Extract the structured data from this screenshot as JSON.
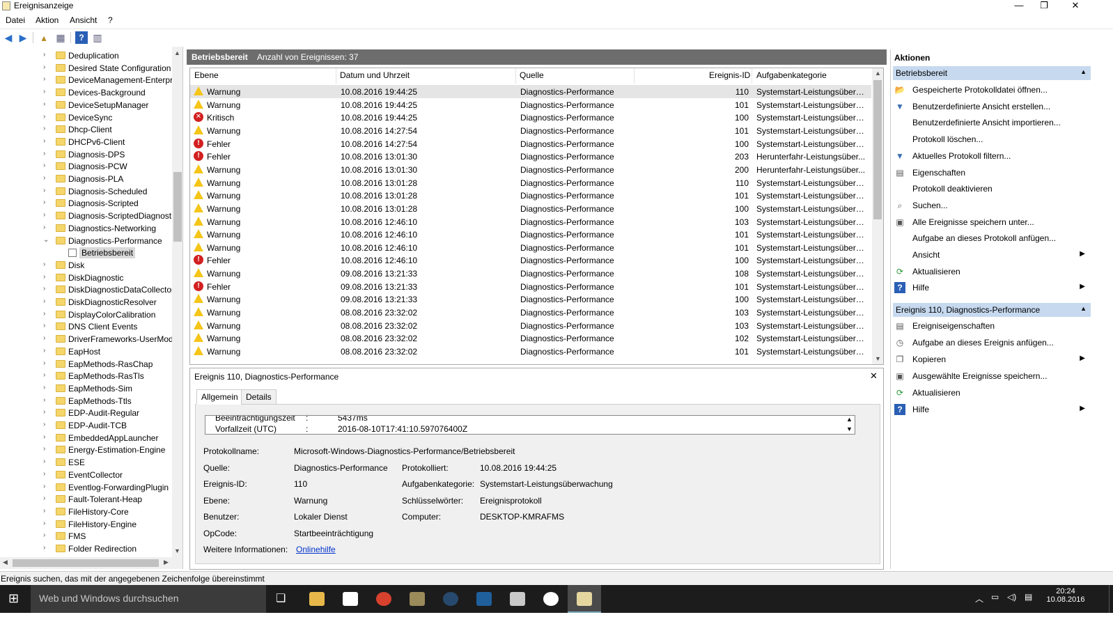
{
  "window": {
    "title": "Ereignisanzeige",
    "minimize": "—",
    "maximize": "❐",
    "close": "✕"
  },
  "menu": [
    "Datei",
    "Aktion",
    "Ansicht",
    "?"
  ],
  "tree": {
    "items": [
      {
        "label": "Deduplication",
        "expanded": false
      },
      {
        "label": "Desired State Configuration",
        "expanded": false
      },
      {
        "label": "DeviceManagement-Enterpri",
        "expanded": false
      },
      {
        "label": "Devices-Background",
        "expanded": false
      },
      {
        "label": "DeviceSetupManager",
        "expanded": false
      },
      {
        "label": "DeviceSync",
        "expanded": false
      },
      {
        "label": "Dhcp-Client",
        "expanded": false
      },
      {
        "label": "DHCPv6-Client",
        "expanded": false
      },
      {
        "label": "Diagnosis-DPS",
        "expanded": false
      },
      {
        "label": "Diagnosis-PCW",
        "expanded": false
      },
      {
        "label": "Diagnosis-PLA",
        "expanded": false
      },
      {
        "label": "Diagnosis-Scheduled",
        "expanded": false
      },
      {
        "label": "Diagnosis-Scripted",
        "expanded": false
      },
      {
        "label": "Diagnosis-ScriptedDiagnosti",
        "expanded": false
      },
      {
        "label": "Diagnostics-Networking",
        "expanded": false
      },
      {
        "label": "Diagnostics-Performance",
        "expanded": true
      },
      {
        "label": "Betriebsbereit",
        "child": true
      },
      {
        "label": "Disk",
        "expanded": false
      },
      {
        "label": "DiskDiagnostic",
        "expanded": false
      },
      {
        "label": "DiskDiagnosticDataCollector",
        "expanded": false
      },
      {
        "label": "DiskDiagnosticResolver",
        "expanded": false
      },
      {
        "label": "DisplayColorCalibration",
        "expanded": false
      },
      {
        "label": "DNS Client Events",
        "expanded": false
      },
      {
        "label": "DriverFrameworks-UserMode",
        "expanded": false
      },
      {
        "label": "EapHost",
        "expanded": false
      },
      {
        "label": "EapMethods-RasChap",
        "expanded": false
      },
      {
        "label": "EapMethods-RasTls",
        "expanded": false
      },
      {
        "label": "EapMethods-Sim",
        "expanded": false
      },
      {
        "label": "EapMethods-Ttls",
        "expanded": false
      },
      {
        "label": "EDP-Audit-Regular",
        "expanded": false
      },
      {
        "label": "EDP-Audit-TCB",
        "expanded": false
      },
      {
        "label": "EmbeddedAppLauncher",
        "expanded": false
      },
      {
        "label": "Energy-Estimation-Engine",
        "expanded": false
      },
      {
        "label": "ESE",
        "expanded": false
      },
      {
        "label": "EventCollector",
        "expanded": false
      },
      {
        "label": "Eventlog-ForwardingPlugin",
        "expanded": false
      },
      {
        "label": "Fault-Tolerant-Heap",
        "expanded": false
      },
      {
        "label": "FileHistory-Core",
        "expanded": false
      },
      {
        "label": "FileHistory-Engine",
        "expanded": false
      },
      {
        "label": "FMS",
        "expanded": false
      },
      {
        "label": "Folder Redirection",
        "expanded": false
      }
    ]
  },
  "center": {
    "title": "Betriebsbereit",
    "count": "Anzahl von Ereignissen: 37"
  },
  "list": {
    "columns": [
      "Ebene",
      "Datum und Uhrzeit",
      "Quelle",
      "Ereignis-ID",
      "Aufgabenkategorie"
    ],
    "rows": [
      {
        "level": "Warnung",
        "type": "warn",
        "date": "10.08.2016 19:44:25",
        "source": "Diagnostics-Performance",
        "id": "110",
        "cat": "Systemstart-Leistungsüberw..."
      },
      {
        "level": "Warnung",
        "type": "warn",
        "date": "10.08.2016 19:44:25",
        "source": "Diagnostics-Performance",
        "id": "101",
        "cat": "Systemstart-Leistungsüberw..."
      },
      {
        "level": "Kritisch",
        "type": "crit",
        "date": "10.08.2016 19:44:25",
        "source": "Diagnostics-Performance",
        "id": "100",
        "cat": "Systemstart-Leistungsüberw..."
      },
      {
        "level": "Warnung",
        "type": "warn",
        "date": "10.08.2016 14:27:54",
        "source": "Diagnostics-Performance",
        "id": "101",
        "cat": "Systemstart-Leistungsüberw..."
      },
      {
        "level": "Fehler",
        "type": "err",
        "date": "10.08.2016 14:27:54",
        "source": "Diagnostics-Performance",
        "id": "100",
        "cat": "Systemstart-Leistungsüberw..."
      },
      {
        "level": "Fehler",
        "type": "err",
        "date": "10.08.2016 13:01:30",
        "source": "Diagnostics-Performance",
        "id": "203",
        "cat": "Herunterfahr-Leistungsüber..."
      },
      {
        "level": "Warnung",
        "type": "warn",
        "date": "10.08.2016 13:01:30",
        "source": "Diagnostics-Performance",
        "id": "200",
        "cat": "Herunterfahr-Leistungsüber..."
      },
      {
        "level": "Warnung",
        "type": "warn",
        "date": "10.08.2016 13:01:28",
        "source": "Diagnostics-Performance",
        "id": "110",
        "cat": "Systemstart-Leistungsüberw..."
      },
      {
        "level": "Warnung",
        "type": "warn",
        "date": "10.08.2016 13:01:28",
        "source": "Diagnostics-Performance",
        "id": "101",
        "cat": "Systemstart-Leistungsüberw..."
      },
      {
        "level": "Warnung",
        "type": "warn",
        "date": "10.08.2016 13:01:28",
        "source": "Diagnostics-Performance",
        "id": "100",
        "cat": "Systemstart-Leistungsüberw..."
      },
      {
        "level": "Warnung",
        "type": "warn",
        "date": "10.08.2016 12:46:10",
        "source": "Diagnostics-Performance",
        "id": "103",
        "cat": "Systemstart-Leistungsüberw..."
      },
      {
        "level": "Warnung",
        "type": "warn",
        "date": "10.08.2016 12:46:10",
        "source": "Diagnostics-Performance",
        "id": "101",
        "cat": "Systemstart-Leistungsüberw..."
      },
      {
        "level": "Warnung",
        "type": "warn",
        "date": "10.08.2016 12:46:10",
        "source": "Diagnostics-Performance",
        "id": "101",
        "cat": "Systemstart-Leistungsüberw..."
      },
      {
        "level": "Fehler",
        "type": "err",
        "date": "10.08.2016 12:46:10",
        "source": "Diagnostics-Performance",
        "id": "100",
        "cat": "Systemstart-Leistungsüberw..."
      },
      {
        "level": "Warnung",
        "type": "warn",
        "date": "09.08.2016 13:21:33",
        "source": "Diagnostics-Performance",
        "id": "108",
        "cat": "Systemstart-Leistungsüberw..."
      },
      {
        "level": "Fehler",
        "type": "err",
        "date": "09.08.2016 13:21:33",
        "source": "Diagnostics-Performance",
        "id": "101",
        "cat": "Systemstart-Leistungsüberw..."
      },
      {
        "level": "Warnung",
        "type": "warn",
        "date": "09.08.2016 13:21:33",
        "source": "Diagnostics-Performance",
        "id": "100",
        "cat": "Systemstart-Leistungsüberw..."
      },
      {
        "level": "Warnung",
        "type": "warn",
        "date": "08.08.2016 23:32:02",
        "source": "Diagnostics-Performance",
        "id": "103",
        "cat": "Systemstart-Leistungsüberw..."
      },
      {
        "level": "Warnung",
        "type": "warn",
        "date": "08.08.2016 23:32:02",
        "source": "Diagnostics-Performance",
        "id": "103",
        "cat": "Systemstart-Leistungsüberw..."
      },
      {
        "level": "Warnung",
        "type": "warn",
        "date": "08.08.2016 23:32:02",
        "source": "Diagnostics-Performance",
        "id": "102",
        "cat": "Systemstart-Leistungsüberw..."
      },
      {
        "level": "Warnung",
        "type": "warn",
        "date": "08.08.2016 23:32:02",
        "source": "Diagnostics-Performance",
        "id": "101",
        "cat": "Systemstart-Leistungsüberw..."
      }
    ]
  },
  "detail": {
    "title": "Ereignis 110, Diagnostics-Performance",
    "tabs": [
      "Allgemein",
      "Details"
    ],
    "xml_line1_label": "Beeinträchtigungszeit",
    "xml_line1_value": "5437ms",
    "xml_line2_label": "Vorfallzeit (UTC)",
    "xml_line2_value": "2016-08-10T17:41:10.597076400Z",
    "colon": ":",
    "fields": {
      "logname_label": "Protokollname:",
      "logname": "Microsoft-Windows-Diagnostics-Performance/Betriebsbereit",
      "source_label": "Quelle:",
      "source": "Diagnostics-Performance",
      "logged_label": "Protokolliert:",
      "logged": "10.08.2016 19:44:25",
      "id_label": "Ereignis-ID:",
      "id": "110",
      "task_label": "Aufgabenkategorie:",
      "task": "Systemstart-Leistungsüberwachung",
      "level_label": "Ebene:",
      "level": "Warnung",
      "keywords_label": "Schlüsselwörter:",
      "keywords": "Ereignisprotokoll",
      "user_label": "Benutzer:",
      "user": "Lokaler Dienst",
      "computer_label": "Computer:",
      "computer": "DESKTOP-KMRAFMS",
      "opcode_label": "OpCode:",
      "opcode": "Startbeeinträchtigung",
      "more_label": "Weitere Informationen:",
      "more_link": "Onlinehilfe"
    }
  },
  "actions": {
    "title": "Aktionen",
    "section1": "Betriebsbereit",
    "items1": [
      {
        "label": "Gespeicherte Protokolldatei öffnen...",
        "icon": "open-folder-icon",
        "glyph": "📂"
      },
      {
        "label": "Benutzerdefinierte Ansicht erstellen...",
        "icon": "filter-icon",
        "glyph": "▼"
      },
      {
        "label": "Benutzerdefinierte Ansicht importieren...",
        "icon": "",
        "glyph": ""
      },
      {
        "label": "Protokoll löschen...",
        "icon": "",
        "glyph": ""
      },
      {
        "label": "Aktuelles Protokoll filtern...",
        "icon": "filter-icon",
        "glyph": "▼"
      },
      {
        "label": "Eigenschaften",
        "icon": "properties-icon",
        "glyph": "▤"
      },
      {
        "label": "Protokoll deaktivieren",
        "icon": "",
        "glyph": ""
      },
      {
        "label": "Suchen...",
        "icon": "binoculars-icon",
        "glyph": "⌕"
      },
      {
        "label": "Alle Ereignisse speichern unter...",
        "icon": "save-icon",
        "glyph": "▣"
      },
      {
        "label": "Aufgabe an dieses Protokoll anfügen...",
        "icon": "",
        "glyph": ""
      },
      {
        "label": "Ansicht",
        "icon": "",
        "glyph": "",
        "sub": true
      },
      {
        "label": "Aktualisieren",
        "icon": "refresh-icon",
        "glyph": "⟳"
      },
      {
        "label": "Hilfe",
        "icon": "help-icon",
        "glyph": "?",
        "sub": true
      }
    ],
    "section2": "Ereignis 110, Diagnostics-Performance",
    "items2": [
      {
        "label": "Ereigniseigenschaften",
        "icon": "properties-icon",
        "glyph": "▤"
      },
      {
        "label": "Aufgabe an dieses Ereignis anfügen...",
        "icon": "task-icon",
        "glyph": "◷"
      },
      {
        "label": "Kopieren",
        "icon": "copy-icon",
        "glyph": "❐",
        "sub": true
      },
      {
        "label": "Ausgewählte Ereignisse speichern...",
        "icon": "save-icon",
        "glyph": "▣"
      },
      {
        "label": "Aktualisieren",
        "icon": "refresh-icon",
        "glyph": "⟳"
      },
      {
        "label": "Hilfe",
        "icon": "help-icon",
        "glyph": "?",
        "sub": true
      }
    ]
  },
  "status": "Ereignis suchen, das mit der angegebenen Zeichenfolge übereinstimmt",
  "taskbar": {
    "search_placeholder": "Web und Windows durchsuchen",
    "time": "20:24",
    "date": "10.08.2016"
  }
}
